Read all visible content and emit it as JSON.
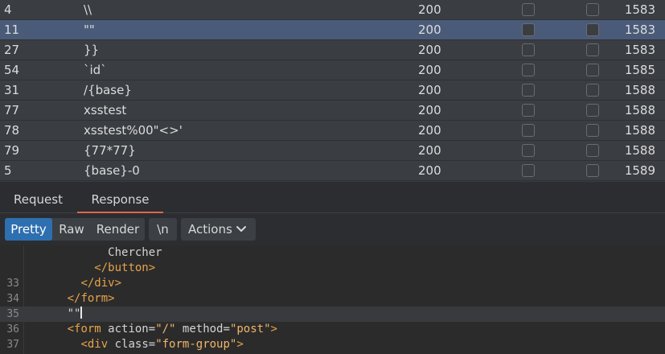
{
  "results": [
    {
      "num": "4",
      "payload": "\\\\",
      "status": "200",
      "length": "1583",
      "selected": false
    },
    {
      "num": "11",
      "payload": "\"\"",
      "status": "200",
      "length": "1583",
      "selected": true
    },
    {
      "num": "27",
      "payload": "}}",
      "status": "200",
      "length": "1583",
      "selected": false
    },
    {
      "num": "54",
      "payload": "`id`",
      "status": "200",
      "length": "1585",
      "selected": false
    },
    {
      "num": "31",
      "payload": "/{base}",
      "status": "200",
      "length": "1588",
      "selected": false
    },
    {
      "num": "77",
      "payload": "xsstest",
      "status": "200",
      "length": "1588",
      "selected": false
    },
    {
      "num": "78",
      "payload": "xsstest%00\"<>'",
      "status": "200",
      "length": "1588",
      "selected": false
    },
    {
      "num": "79",
      "payload": "{77*77}",
      "status": "200",
      "length": "1588",
      "selected": false
    },
    {
      "num": "5",
      "payload": "{base}-0",
      "status": "200",
      "length": "1589",
      "selected": false
    }
  ],
  "tabs": {
    "request": "Request",
    "response": "Response"
  },
  "toolbar": {
    "pretty": "Pretty",
    "raw": "Raw",
    "render": "Render",
    "newline": "\\n",
    "actions": "Actions"
  },
  "editor": {
    "lines": [
      {
        "ln": "",
        "indent": "            ",
        "parts": [
          [
            "t",
            "Chercher"
          ]
        ]
      },
      {
        "ln": "",
        "indent": "          ",
        "parts": [
          [
            "tag",
            "</"
          ],
          [
            "tag",
            "button"
          ],
          [
            "tag",
            ">"
          ]
        ]
      },
      {
        "ln": "33",
        "indent": "        ",
        "parts": [
          [
            "tag",
            "</"
          ],
          [
            "tag",
            "div"
          ],
          [
            "tag",
            ">"
          ]
        ]
      },
      {
        "ln": "34",
        "indent": "      ",
        "parts": [
          [
            "tag",
            "</"
          ],
          [
            "tag",
            "form"
          ],
          [
            "tag",
            ">"
          ]
        ]
      },
      {
        "ln": "35",
        "indent": "      ",
        "parts": [
          [
            "t",
            "\"\""
          ]
        ],
        "current": true
      },
      {
        "ln": "36",
        "indent": "      ",
        "parts": [
          [
            "tag",
            "<"
          ],
          [
            "tag",
            "form"
          ],
          [
            "attr",
            " action"
          ],
          [
            "t",
            "="
          ],
          [
            "val",
            "\"/\""
          ],
          [
            "attr",
            " method"
          ],
          [
            "t",
            "="
          ],
          [
            "val",
            "\"post\""
          ],
          [
            "tag",
            ">"
          ]
        ]
      },
      {
        "ln": "37",
        "indent": "        ",
        "parts": [
          [
            "tag",
            "<"
          ],
          [
            "tag",
            "div"
          ],
          [
            "attr",
            " class"
          ],
          [
            "t",
            "="
          ],
          [
            "val",
            "\"form-group\""
          ],
          [
            "tag",
            ">"
          ]
        ]
      }
    ]
  }
}
